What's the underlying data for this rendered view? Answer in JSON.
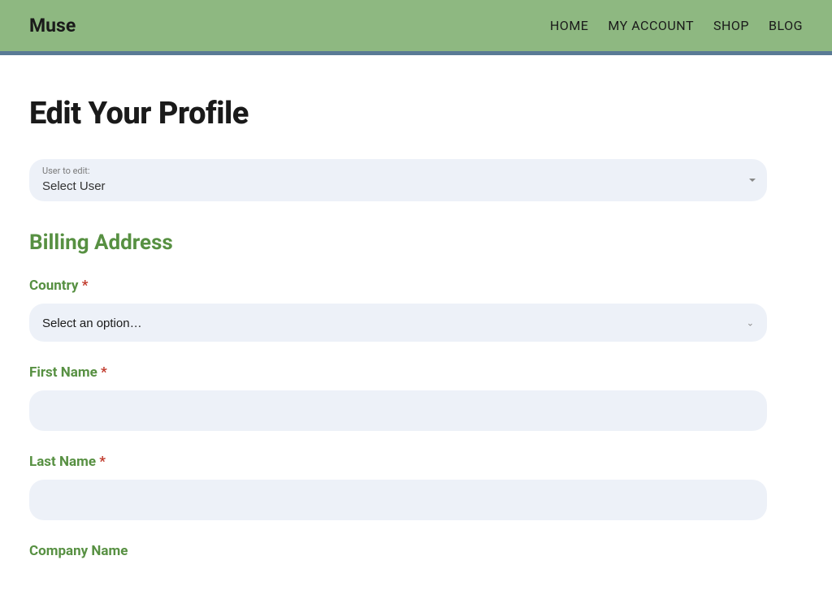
{
  "header": {
    "brand": "Muse",
    "nav": {
      "home": "HOME",
      "my_account": "MY ACCOUNT",
      "shop": "SHOP",
      "blog": "BLOG"
    }
  },
  "page": {
    "title": "Edit Your Profile"
  },
  "user_select": {
    "label": "User to edit:",
    "value": "Select User"
  },
  "billing": {
    "section_title": "Billing Address",
    "country": {
      "label": "Country",
      "required": "*",
      "placeholder": "Select an option…"
    },
    "first_name": {
      "label": "First Name",
      "required": "*",
      "value": ""
    },
    "last_name": {
      "label": "Last Name",
      "required": "*",
      "value": ""
    },
    "company_name": {
      "label": "Company Name",
      "value": ""
    }
  }
}
